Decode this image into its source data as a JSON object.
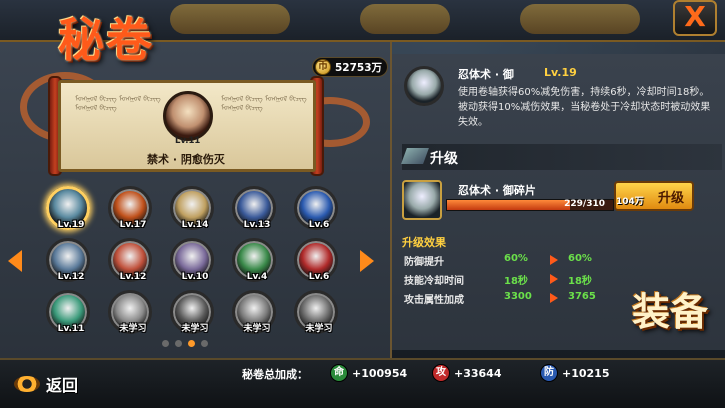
{
  "title": "秘卷",
  "close_label": "X",
  "currency": {
    "coin_symbol": "币",
    "amount": "52753万"
  },
  "scroll": {
    "level": "Lv.11",
    "name": "禁术 · 阴愈伤灭"
  },
  "skills": [
    {
      "level": "Lv.19",
      "color": "#5a8aa0",
      "selected": true
    },
    {
      "level": "Lv.17",
      "color": "#c0501a"
    },
    {
      "level": "Lv.14",
      "color": "#c0a060"
    },
    {
      "level": "Lv.13",
      "color": "#3a5a9a"
    },
    {
      "level": "Lv.6",
      "color": "#2a5ab0"
    },
    {
      "level": "Lv.12",
      "color": "#5a7a9a"
    },
    {
      "level": "Lv.12",
      "color": "#c0503a"
    },
    {
      "level": "Lv.10",
      "color": "#7a6a9a"
    },
    {
      "level": "Lv.4",
      "color": "#3a8a4a"
    },
    {
      "level": "Lv.6",
      "color": "#b02a2a"
    },
    {
      "level": "Lv.11",
      "color": "#3a9a7a"
    },
    {
      "level": "未学习",
      "color": "#8a8a8a"
    },
    {
      "level": "未学习",
      "color": "#5a5a5a"
    },
    {
      "level": "未学习",
      "color": "#7a7a7a"
    },
    {
      "level": "未学习",
      "color": "#6a6a6a"
    }
  ],
  "detail": {
    "name": "忍体术 · 御",
    "level": "Lv.19",
    "description": "使用卷轴获得60%减免伤害，持续6秒，冷却时间18秒。被动获得10%减伤效果，当秘卷处于冷却状态时被动效果失效。"
  },
  "upgrade": {
    "title": "升级",
    "material_name": "忍体术 · 御碎片",
    "progress_text": "229/310",
    "progress": 0.7387,
    "button_label": "升级",
    "cost": "104万"
  },
  "effects": {
    "title": "升级效果",
    "rows": [
      {
        "label": "防御提升",
        "from": "60%",
        "to": "60%"
      },
      {
        "label": "技能冷却时间",
        "from": "18秒",
        "to": "18秒"
      },
      {
        "label": "攻击属性加成",
        "from": "3300",
        "to": "3765"
      }
    ]
  },
  "equip_label": "装备",
  "bottom": {
    "back_label": "返回",
    "total_label": "秘卷总加成：",
    "stats": [
      {
        "icon": "命",
        "value": "+100954",
        "color": "#2a8a3a"
      },
      {
        "icon": "攻",
        "value": "+33644",
        "color": "#c02a2a"
      },
      {
        "icon": "防",
        "value": "+10215",
        "color": "#2a5ab0"
      }
    ]
  }
}
